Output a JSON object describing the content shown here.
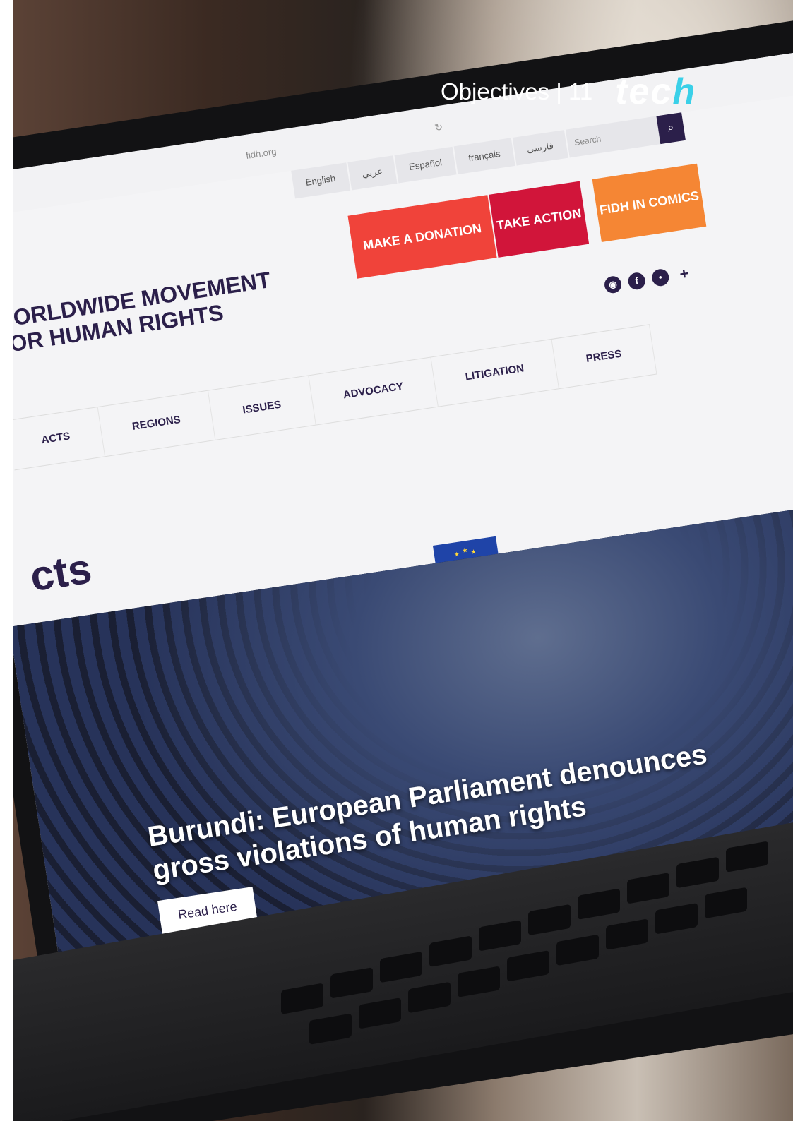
{
  "page_header": {
    "section_label": "Objectives | 11",
    "logo_text_main": "tec",
    "logo_text_h": "h"
  },
  "browser": {
    "url": "fidh.org",
    "reload_icon": "↻"
  },
  "site": {
    "languages": [
      "English",
      "عربي",
      "Español",
      "français",
      "فارسی"
    ],
    "search_placeholder": "Search",
    "search_icon": "search-icon",
    "logo_title": "WORLDWIDE MOVEMENT FOR HUMAN RIGHTS",
    "cta": {
      "donate": "MAKE A DONATION",
      "action": "TAKE ACTION",
      "comics": "FIDH IN COMICS"
    },
    "social": [
      "rss-icon",
      "facebook-icon",
      "twitter-icon",
      "plus-icon"
    ],
    "nav": [
      "ACTS",
      "REGIONS",
      "ISSUES",
      "ADVOCACY",
      "LITIGATION",
      "PRESS"
    ],
    "hero_title": "cts",
    "headline": "Burundi: European Parliament denounces gross violations of human rights",
    "read_more": "Read here"
  },
  "colors": {
    "brand_dark": "#2b1f4a",
    "donate_red": "#f0433a",
    "action_crimson": "#d1153a",
    "comics_orange": "#f58634",
    "eu_blue": "#1f44a8",
    "tech_accent": "#3ad0e8"
  }
}
